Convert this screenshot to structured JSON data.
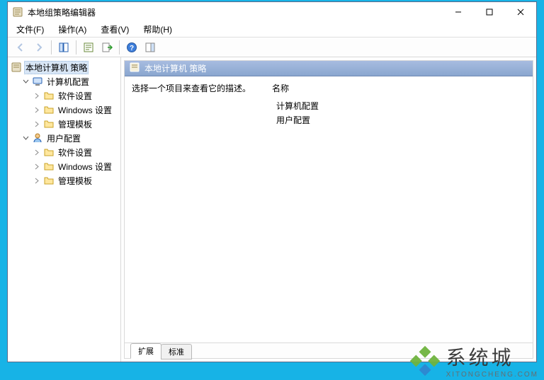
{
  "window": {
    "title": "本地组策略编辑器"
  },
  "menu": {
    "file": "文件(F)",
    "action": "操作(A)",
    "view": "查看(V)",
    "help": "帮助(H)"
  },
  "toolbar_icons": {
    "back": "back-arrow-icon",
    "forward": "forward-arrow-icon",
    "up": "up-icon",
    "show_hide_tree": "show-hide-tree-icon",
    "properties": "properties-icon",
    "export": "export-list-icon",
    "help": "help-icon",
    "action_pane": "show-hide-action-pane-icon"
  },
  "tree": {
    "root": "本地计算机 策略",
    "computer": "计算机配置",
    "user": "用户配置",
    "software": "软件设置",
    "windows": "Windows 设置",
    "templates": "管理模板"
  },
  "content": {
    "header": "本地计算机 策略",
    "desc": "选择一个项目来查看它的描述。",
    "name_col": "名称",
    "items": {
      "computer": "计算机配置",
      "user": "用户配置"
    }
  },
  "tabs": {
    "extended": "扩展",
    "standard": "标准"
  },
  "watermark": {
    "brand": "系统城",
    "url": "XITONGCHENG.COM"
  }
}
